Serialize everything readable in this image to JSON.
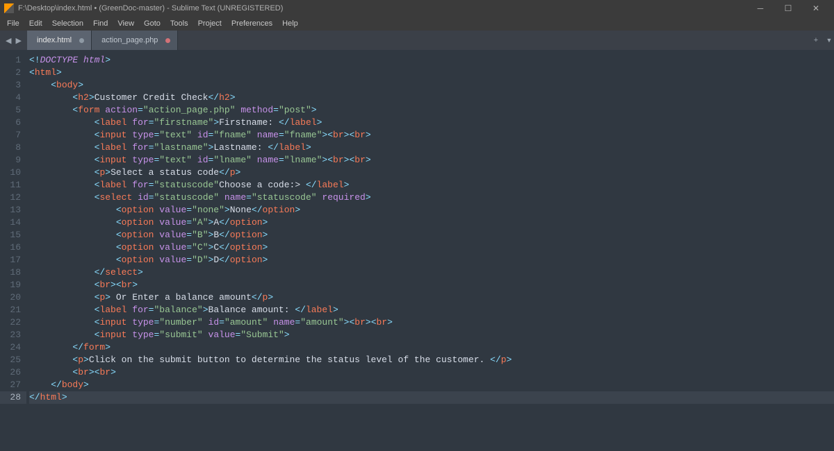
{
  "titlebar": {
    "text": "F:\\Desktop\\index.html • (GreenDoc-master) - Sublime Text (UNREGISTERED)"
  },
  "menu": [
    "File",
    "Edit",
    "Selection",
    "Find",
    "View",
    "Goto",
    "Tools",
    "Project",
    "Preferences",
    "Help"
  ],
  "tabs": [
    {
      "label": "index.html",
      "modified": true,
      "active": true,
      "dotColor": "gray"
    },
    {
      "label": "action_page.php",
      "modified": true,
      "active": false,
      "dotColor": "red"
    }
  ],
  "lineNumbers": [
    "1",
    "2",
    "3",
    "4",
    "5",
    "6",
    "7",
    "8",
    "9",
    "10",
    "11",
    "12",
    "13",
    "14",
    "15",
    "16",
    "17",
    "18",
    "19",
    "20",
    "21",
    "22",
    "23",
    "24",
    "25",
    "26",
    "27",
    "28"
  ],
  "currentLine": 28,
  "code": {
    "l1": {
      "doctype": "DOCTYPE",
      "html": "html"
    },
    "l2": {
      "tag": "html"
    },
    "l3": {
      "tag": "body"
    },
    "l4": {
      "tag": "h2",
      "text": "Customer Credit Check"
    },
    "l5": {
      "tag": "form",
      "attrs": {
        "action": "action_page.php",
        "method": "post"
      }
    },
    "l6": {
      "tag": "label",
      "for": "firstname",
      "text": "Firstname: "
    },
    "l7": {
      "tag": "input",
      "type": "text",
      "id": "fname",
      "name": "fname"
    },
    "l8": {
      "tag": "label",
      "for": "lastname",
      "text": "Lastname: "
    },
    "l9": {
      "tag": "input",
      "type": "text",
      "id": "lname",
      "name": "lname"
    },
    "l10": {
      "tag": "p",
      "text": "Select a status code"
    },
    "l11": {
      "tag": "label",
      "for": "statuscode",
      "text": "Choose a code:> "
    },
    "l12": {
      "tag": "select",
      "id": "statuscode",
      "name": "statuscode",
      "required": true
    },
    "l13": {
      "tag": "option",
      "value": "none",
      "text": "None"
    },
    "l14": {
      "tag": "option",
      "value": "A",
      "text": "A"
    },
    "l15": {
      "tag": "option",
      "value": "B",
      "text": "B"
    },
    "l16": {
      "tag": "option",
      "value": "C",
      "text": "C"
    },
    "l17": {
      "tag": "option",
      "value": "D",
      "text": "D"
    },
    "l18": {
      "close": "select"
    },
    "l19": {
      "br": 2
    },
    "l20": {
      "tag": "p",
      "text": " Or Enter a balance amount"
    },
    "l21": {
      "tag": "label",
      "for": "balance",
      "text": "Balance amount: "
    },
    "l22": {
      "tag": "input",
      "type": "number",
      "id": "amount",
      "name": "amount"
    },
    "l23": {
      "tag": "input",
      "type": "submit",
      "value": "Submit"
    },
    "l24": {
      "close": "form"
    },
    "l25": {
      "tag": "p",
      "text": "Click on the submit button to determine the status level of the customer. "
    },
    "l26": {
      "br": 2
    },
    "l27": {
      "close": "body"
    },
    "l28": {
      "close": "html"
    }
  }
}
